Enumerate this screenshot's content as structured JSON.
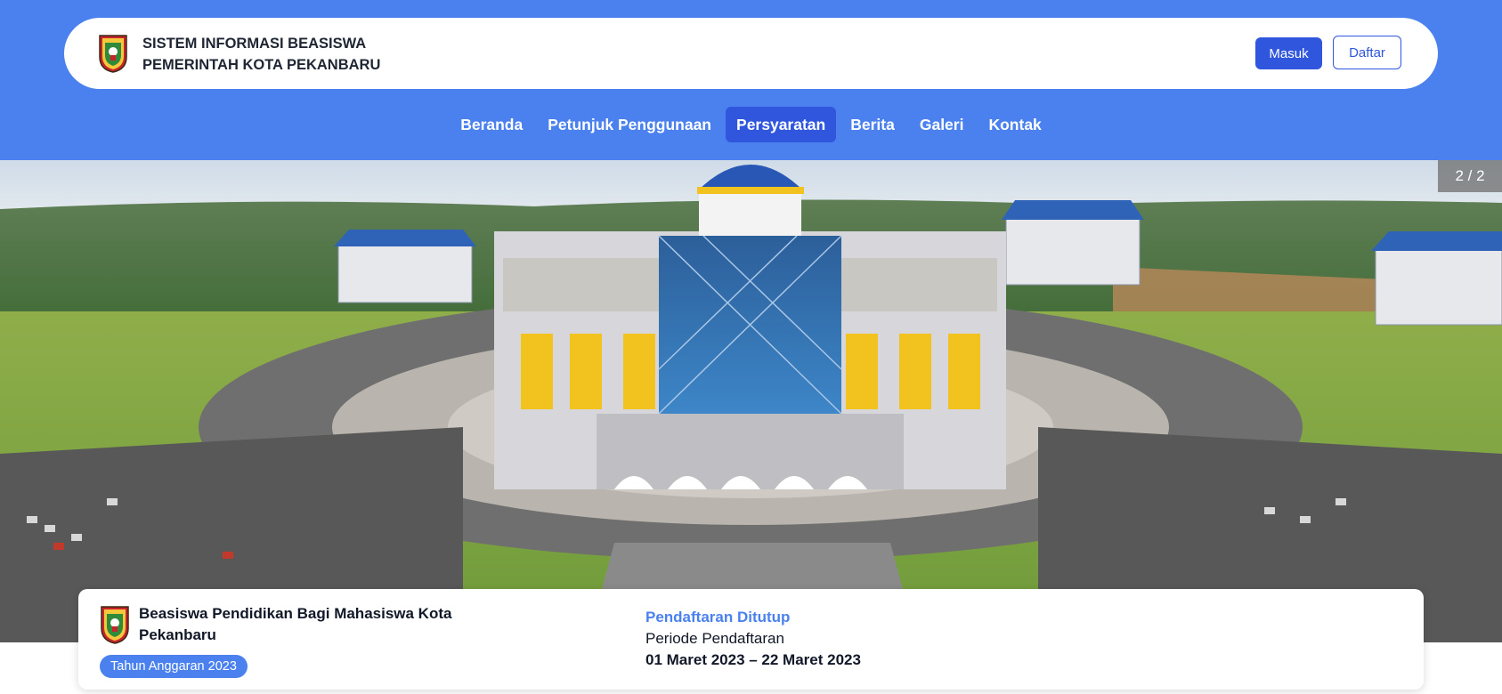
{
  "header": {
    "brand_line1": "SISTEM INFORMASI BEASISWA",
    "brand_line2": "PEMERINTAH KOTA PEKANBARU",
    "login_label": "Masuk",
    "register_label": "Daftar"
  },
  "nav": {
    "items": [
      {
        "label": "Beranda"
      },
      {
        "label": "Petunjuk Penggunaan"
      },
      {
        "label": "Persyaratan",
        "active": true
      },
      {
        "label": "Berita"
      },
      {
        "label": "Galeri"
      },
      {
        "label": "Kontak"
      }
    ]
  },
  "hero": {
    "slide_counter": "2 / 2",
    "image_icon": "government-building-photo"
  },
  "scholarship": {
    "title": "Beasiswa Pendidikan Bagi Mahasiswa Kota Pekanbaru",
    "budget_year": "Tahun Anggaran 2023",
    "status": "Pendaftaran Ditutup",
    "period_label": "Periode Pendaftaran",
    "period_dates": "01 Maret 2023 – 22 Maret 2023"
  },
  "colors": {
    "primary": "#4a81ee",
    "button": "#2f56dc"
  }
}
